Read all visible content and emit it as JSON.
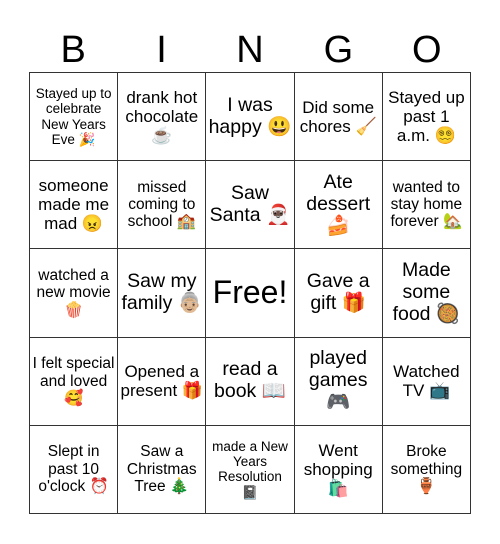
{
  "header": {
    "letters": [
      "B",
      "I",
      "N",
      "G",
      "O"
    ]
  },
  "cells": [
    [
      {
        "text": "Stayed up to celebrate New Years Eve 🎉",
        "icon": "party-popper"
      },
      {
        "text": "drank hot chocolate ☕",
        "icon": "hot-beverage"
      },
      {
        "text": "I was happy 😃",
        "icon": "grinning-face"
      },
      {
        "text": "Did some chores 🧹",
        "icon": "broom"
      },
      {
        "text": "Stayed up past 1 a.m. 😵‍💫",
        "icon": "dizzy-face"
      }
    ],
    [
      {
        "text": "someone made me mad 😠",
        "icon": "angry-face"
      },
      {
        "text": "missed coming to school 🏫",
        "icon": "school"
      },
      {
        "text": "Saw Santa 🎅🏿",
        "icon": "santa"
      },
      {
        "text": "Ate dessert 🍰",
        "icon": "shortcake"
      },
      {
        "text": "wanted to stay home forever 🏡",
        "icon": "house-with-garden"
      }
    ],
    [
      {
        "text": "watched a new movie 🍿",
        "icon": "popcorn"
      },
      {
        "text": "Saw my family 👵🏼",
        "icon": "old-woman"
      },
      {
        "text": "Free!",
        "icon": ""
      },
      {
        "text": "Gave a gift 🎁",
        "icon": "gift"
      },
      {
        "text": "Made some food 🥘",
        "icon": "paella"
      }
    ],
    [
      {
        "text": "I felt special and loved 🥰",
        "icon": "smiling-face-with-hearts"
      },
      {
        "text": "Opened a present 🎁",
        "icon": "gift"
      },
      {
        "text": "read a book 📖",
        "icon": "open-book"
      },
      {
        "text": "played games 🎮",
        "icon": "game-controller"
      },
      {
        "text": "Watched TV 📺",
        "icon": "television"
      }
    ],
    [
      {
        "text": "Slept in past 10 o'clock ⏰",
        "icon": "alarm-clock"
      },
      {
        "text": "Saw a Christmas Tree 🎄",
        "icon": "christmas-tree"
      },
      {
        "text": "made a New Years Resolution 📓",
        "icon": "notebook"
      },
      {
        "text": "Went shopping 🛍️",
        "icon": "shopping-bags"
      },
      {
        "text": "Broke something 🏺",
        "icon": "amphora"
      }
    ]
  ]
}
